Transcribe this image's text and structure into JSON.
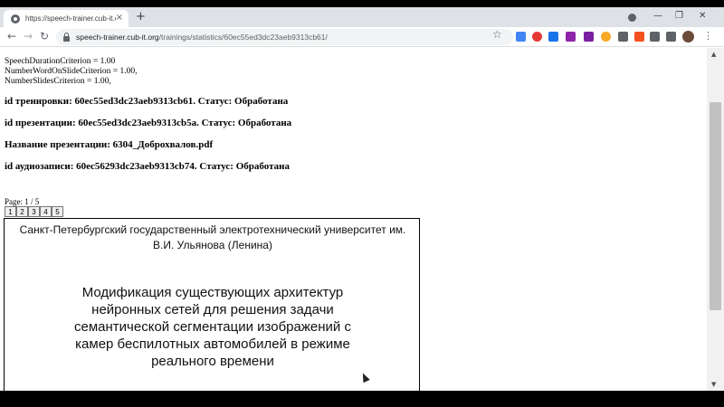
{
  "browser": {
    "tab_title": "https://speech-trainer.cub-it.org",
    "tab_close": "×",
    "new_tab": "+",
    "url_host": "speech-trainer.cub-it.org",
    "url_path": "/trainings/statistics/60ec55ed3dc23aeb9313cb61/",
    "back": "←",
    "forward": "→",
    "reload": "↻",
    "star": "☆",
    "menu": "⋮",
    "minimize": "—",
    "restore": "❐",
    "close_window": "✕",
    "extension_colors": [
      "#4285f4",
      "#e53935",
      "#1a73e8",
      "#8e24aa",
      "#7b1fa2",
      "#f9a825",
      "#5f6368",
      "#f4511e",
      "#5f6368",
      "#5f6368"
    ]
  },
  "criteria": [
    "SpeechDurationCriterion = 1.00",
    "NumberWordOnSlideCriterion = 1.00,",
    "NumberSlidesCriterion = 1.00,"
  ],
  "info": {
    "training": "id тренировки: 60ec55ed3dc23aeb9313cb61. Статус: Обработана",
    "presentation": "id презентации: 60ec55ed3dc23aeb9313cb5a. Статус: Обработана",
    "presentation_name": "Название презентации: 6304_Доброхвалов.pdf",
    "audio": "id аудиозаписи: 60ec56293dc23aeb9313cb74. Статус: Обработана"
  },
  "pager": {
    "label": "Page: 1 / 5",
    "buttons": [
      "1",
      "2",
      "3",
      "4",
      "5"
    ]
  },
  "slide": {
    "university_line1": "Санкт-Петербургский государственный электротехнический университет им.",
    "university_line2": "В.И. Ульянова (Ленина)",
    "title_line1": "Модификация существующих архитектур",
    "title_line2": "нейронных сетей для решения задачи",
    "title_line3": "семантической сегментации изображений с",
    "title_line4": "камер беспилотных автомобилей в режиме",
    "title_line5": "реального времени"
  }
}
